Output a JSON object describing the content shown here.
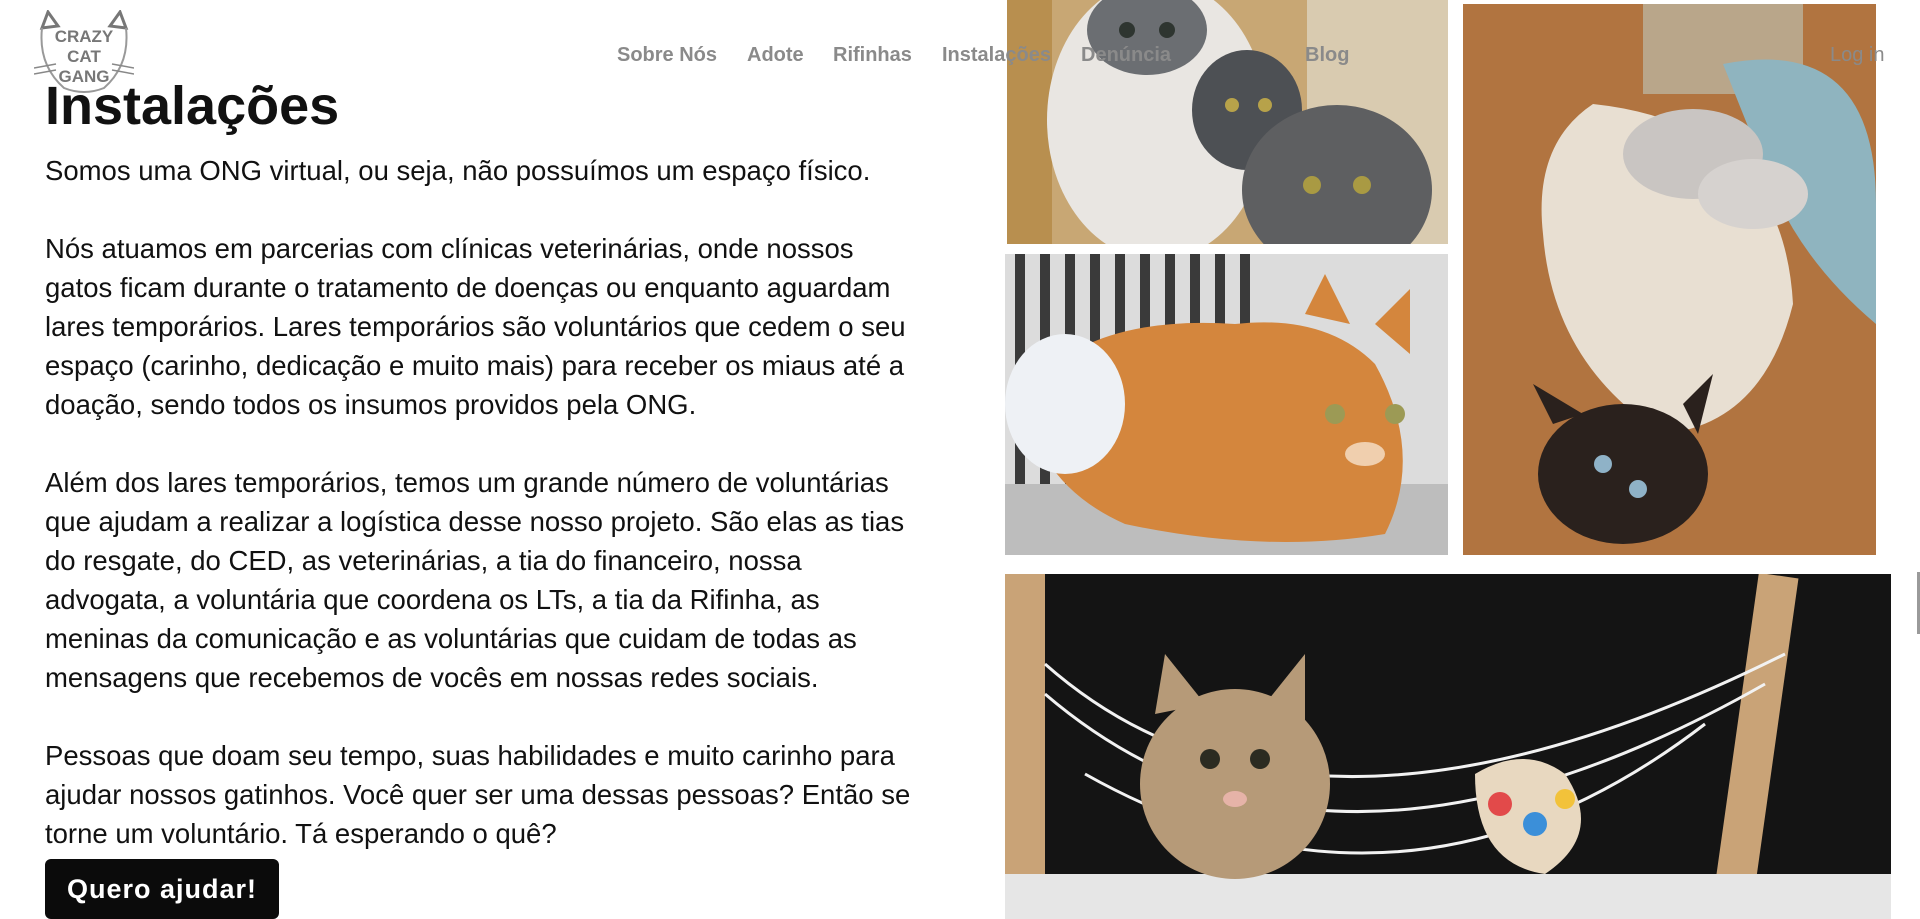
{
  "brand": {
    "logo_text": "CRAZY CAT GANG"
  },
  "nav": {
    "items": [
      {
        "label": "Sobre Nós"
      },
      {
        "label": "Adote"
      },
      {
        "label": "Rifinhas"
      },
      {
        "label": "Instalações"
      },
      {
        "label": "Denúncia"
      },
      {
        "label": "Blog"
      }
    ],
    "login": "Log in"
  },
  "main": {
    "title": "Instalações",
    "paragraphs": [
      "Somos uma ONG virtual, ou seja, não possuímos um espaço físico.",
      "Nós atuamos em parcerias com clínicas veterinárias, onde nossos gatos ficam durante o tratamento de doenças ou enquanto aguardam lares temporários. Lares temporários são voluntários que cedem o seu espaço (carinho, dedicação e muito mais) para receber os miaus até a doação, sendo todos os insumos providos pela ONG.",
      "Além dos lares temporários, temos um grande número de voluntárias que ajudam a realizar a logística desse nosso projeto. São elas as tias do resgate, do CED, as veterinárias, a tia do financeiro, nossa advogata, a voluntária que coordena os LTs, a tia da Rifinha, as meninas da comunicação e as voluntárias que cuidam de todas as mensagens que recebemos de vocês em nossas redes sociais.",
      "Pessoas que doam seu tempo, suas habilidades e muito carinho para ajudar nossos gatinhos. Você quer ser uma dessas pessoas? Então se torne um voluntário. Tá esperando o quê?"
    ],
    "cta": "Quero ajudar!"
  },
  "colors": {
    "cta_bg": "#0b0b0b",
    "nav_text": "#8a8a8a"
  }
}
